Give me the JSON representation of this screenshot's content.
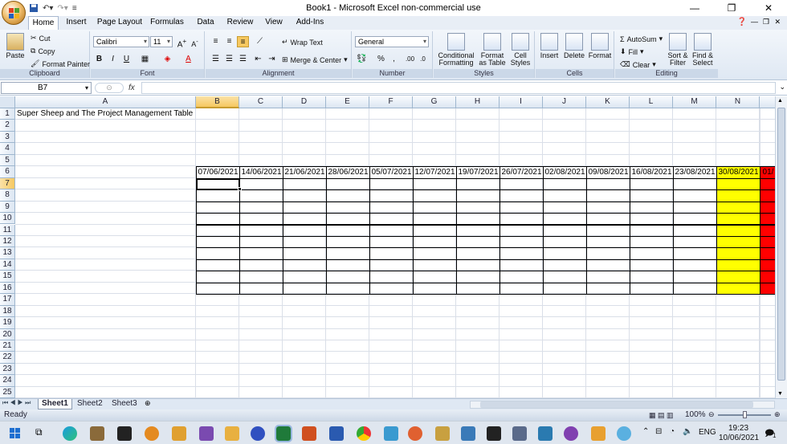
{
  "window": {
    "title": "Book1 - Microsoft Excel non-commercial use"
  },
  "tabs": [
    "Home",
    "Insert",
    "Page Layout",
    "Formulas",
    "Data",
    "Review",
    "View",
    "Add-Ins"
  ],
  "ribbon": {
    "clipboard": {
      "label": "Clipboard",
      "paste": "Paste",
      "cut": "Cut",
      "copy": "Copy",
      "format_painter": "Format Painter"
    },
    "font": {
      "label": "Font",
      "font_name": "Calibri",
      "font_size": "11"
    },
    "alignment": {
      "label": "Alignment",
      "wrap_text": "Wrap Text",
      "merge_center": "Merge & Center"
    },
    "number": {
      "label": "Number",
      "format": "General"
    },
    "styles": {
      "label": "Styles",
      "conditional": "Conditional Formatting",
      "format_table": "Format as Table",
      "cell_styles": "Cell Styles"
    },
    "cells": {
      "label": "Cells",
      "insert": "Insert",
      "delete": "Delete",
      "format": "Format"
    },
    "editing": {
      "label": "Editing",
      "autosum": "AutoSum",
      "fill": "Fill",
      "clear": "Clear",
      "sort": "Sort & Filter",
      "find": "Find & Select"
    }
  },
  "formula_bar": {
    "name_box": "B7",
    "fx": "fx",
    "value": ""
  },
  "columns": [
    "A",
    "B",
    "C",
    "D",
    "E",
    "F",
    "G",
    "H",
    "I",
    "J",
    "K",
    "L",
    "M",
    "N"
  ],
  "rows": [
    "1",
    "2",
    "3",
    "4",
    "5",
    "6",
    "7",
    "8",
    "9",
    "10",
    "11",
    "12",
    "13",
    "14",
    "15",
    "16",
    "17",
    "18",
    "19",
    "20",
    "21",
    "22",
    "23",
    "24",
    "25"
  ],
  "cells": {
    "A1": "Super Sheep and The Project Management Table",
    "dates": [
      "07/06/2021",
      "14/06/2021",
      "21/06/2021",
      "28/06/2021",
      "05/07/2021",
      "12/07/2021",
      "19/07/2021",
      "26/07/2021",
      "02/08/2021",
      "09/08/2021",
      "16/08/2021",
      "23/08/2021",
      "30/08/2021",
      "01/"
    ]
  },
  "sheets": [
    "Sheet1",
    "Sheet2",
    "Sheet3"
  ],
  "status": {
    "ready": "Ready",
    "zoom": "100%"
  },
  "taskbar": {
    "lang": "ENG",
    "time": "19:23",
    "date": "10/06/2021",
    "notif": "1"
  },
  "colors": {
    "yellow": "#ffff00",
    "red": "#ff0000",
    "selected_header": "#f6c860"
  }
}
